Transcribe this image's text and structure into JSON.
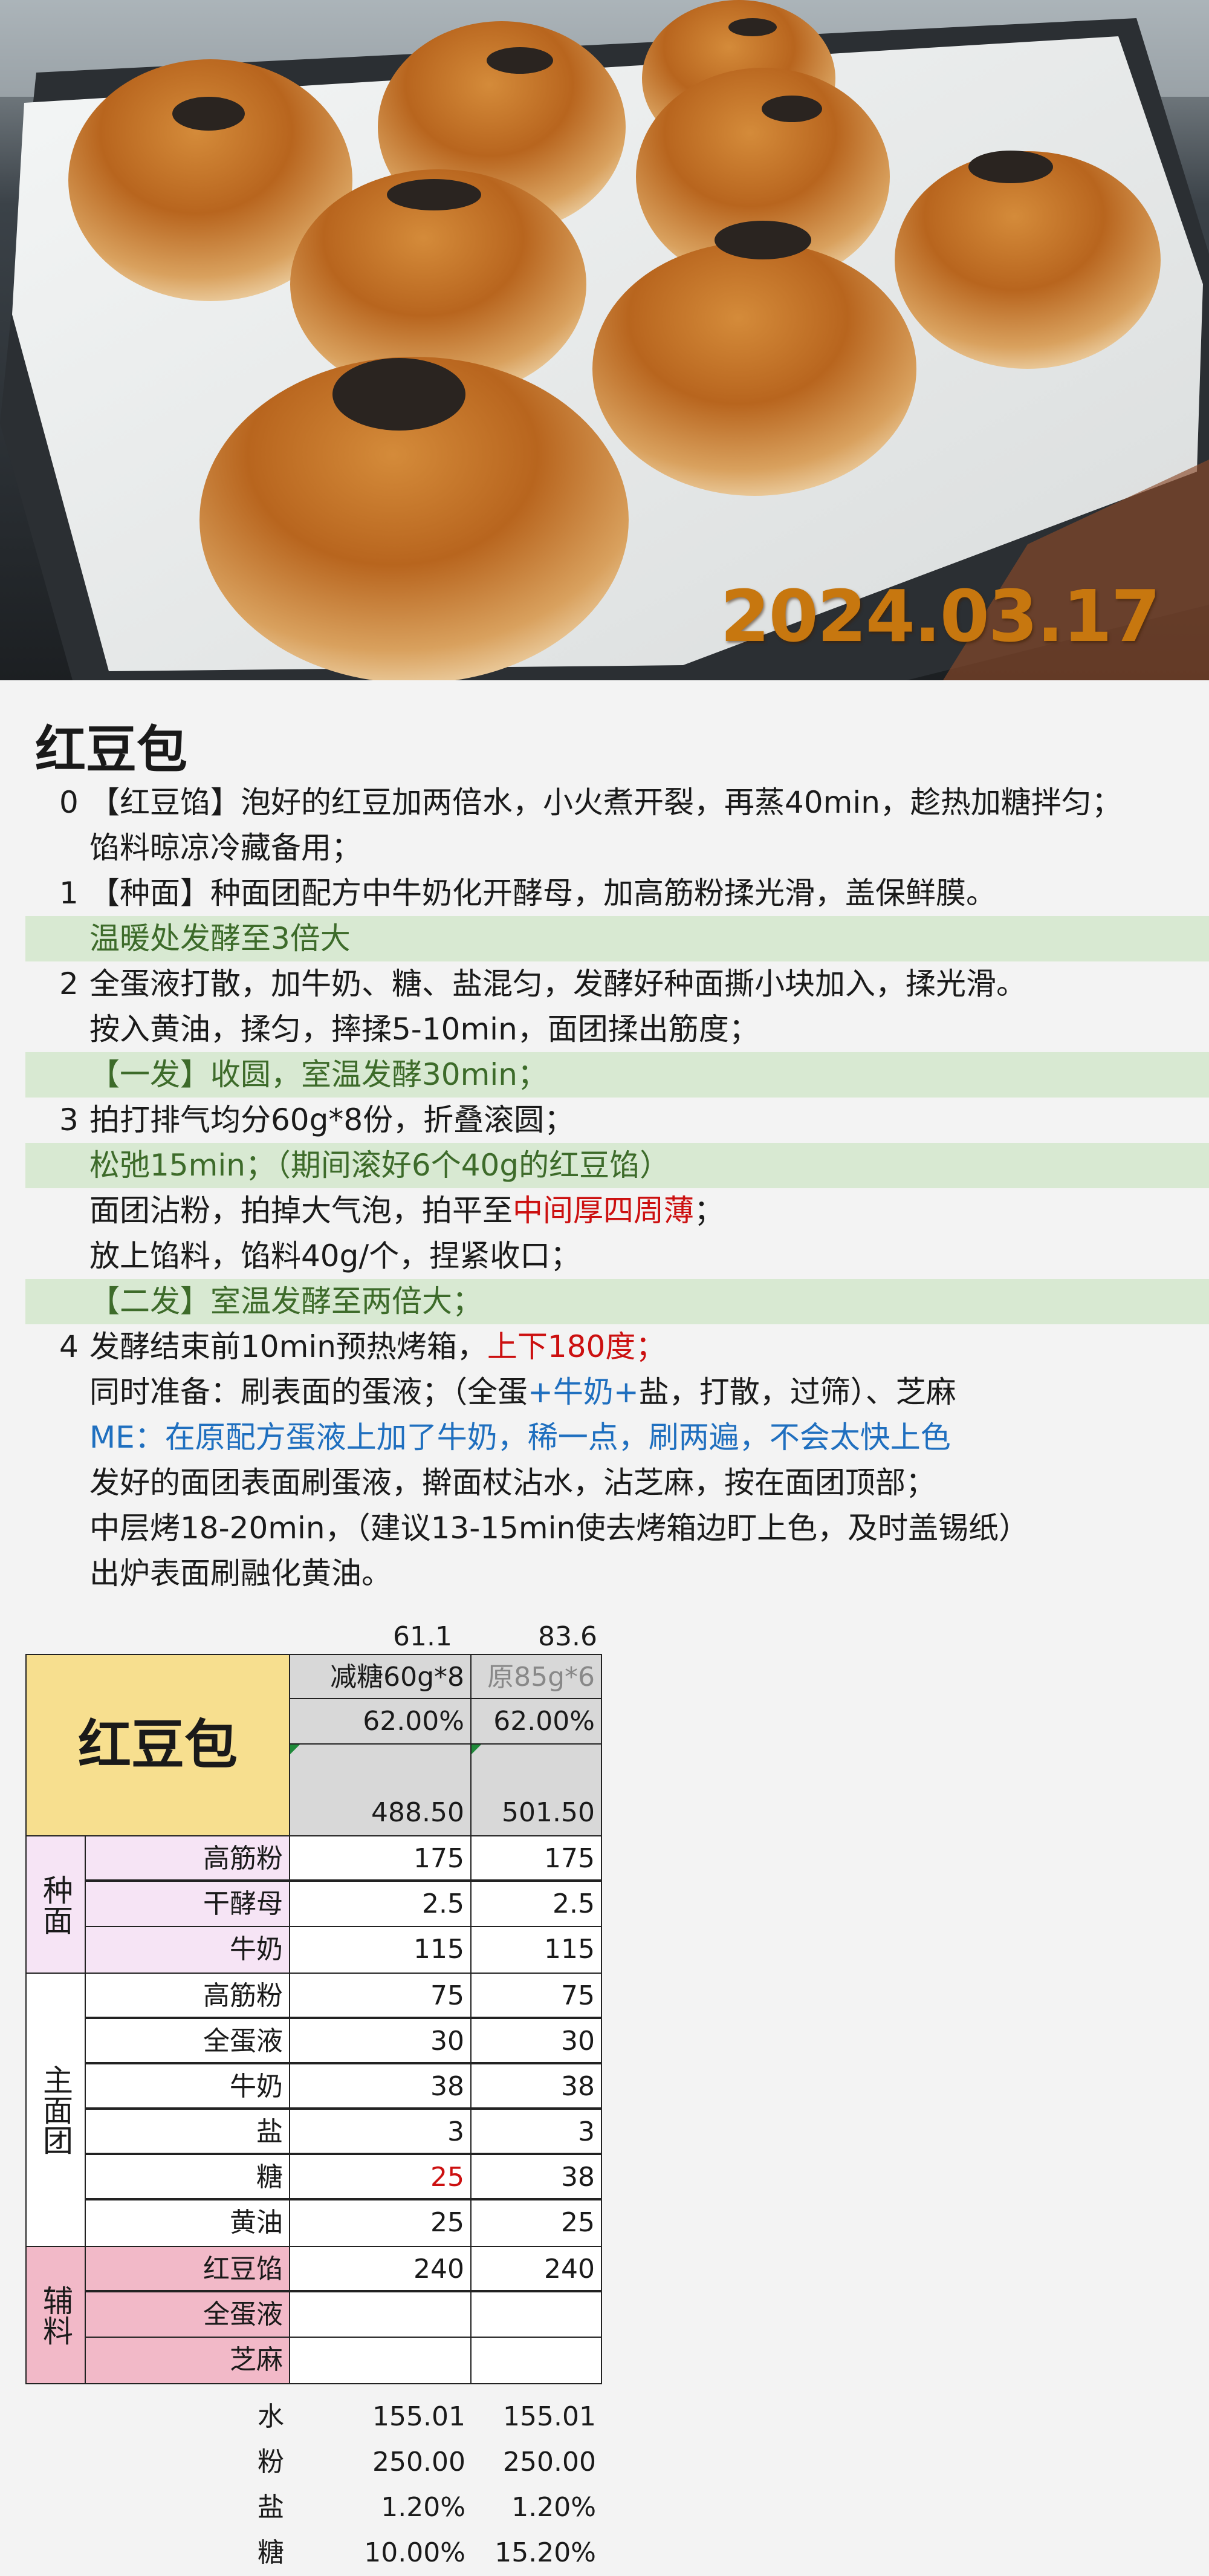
{
  "photo": {
    "date_stamp": "2024.03.17",
    "colors": {
      "stamp": "#c7770f",
      "bun": "#c8782e",
      "paper": "#eef0f0"
    }
  },
  "recipe": {
    "title": "红豆包",
    "steps": [
      {
        "num": "0",
        "text": "【红豆馅】泡好的红豆加两倍水，小火煮开裂，再蒸40min，趁热加糖拌匀；"
      },
      {
        "num": "",
        "text": "馅料晾凉冷藏备用；"
      },
      {
        "num": "1",
        "text": "【种面】种面团配方中牛奶化开酵母，加高筋粉揉光滑，盖保鲜膜。"
      },
      {
        "num": "",
        "text": "温暖处发酵至3倍大",
        "highlight": true
      },
      {
        "num": "2",
        "text": "全蛋液打散，加牛奶、糖、盐混匀，发酵好种面撕小块加入，揉光滑。"
      },
      {
        "num": "",
        "text": "按入黄油，揉匀，摔揉5-10min，面团揉出筋度；"
      },
      {
        "num": "",
        "text": "【一发】收圆，室温发酵30min；",
        "highlight": true
      },
      {
        "num": "3",
        "text": "拍打排气均分60g*8份，折叠滚圆；"
      },
      {
        "num": "",
        "text": "松弛15min；（期间滚好6个40g的红豆馅）",
        "highlight": true
      },
      {
        "num": "",
        "text_a": "面团沾粉，拍掉大气泡，拍平至",
        "text_b": "中间厚四周薄",
        "text_c": "；"
      },
      {
        "num": "",
        "text": "放上馅料，馅料40g/个，捏紧收口；"
      },
      {
        "num": "",
        "text": "【二发】室温发酵至两倍大；",
        "highlight": true
      },
      {
        "num": "4",
        "text_a": "发酵结束前10min预热烤箱，",
        "text_b": "上下180度；"
      },
      {
        "num": "",
        "text_a": "同时准备：刷表面的蛋液；（全蛋",
        "text_b": "+牛奶+",
        "text_c": "盐，打散，过筛）、芝麻"
      },
      {
        "num": "",
        "text": "ME：在原配方蛋液上加了牛奶，稀一点，刷两遍，不会太快上色"
      },
      {
        "num": "",
        "text": "发好的面团表面刷蛋液，擀面杖沾水，沾芝麻，按在面团顶部；"
      },
      {
        "num": "",
        "text": "中层烤18-20min，（建议13-15min使去烤箱边盯上色，及时盖锡纸）"
      },
      {
        "num": "",
        "text": "出炉表面刷融化黄油。"
      }
    ]
  },
  "sheet": {
    "top_values": [
      "61.1",
      "83.6"
    ],
    "title": "红豆包",
    "col_headers": [
      "减糖60g*8",
      "原85g*6"
    ],
    "hydration": [
      "62.00%",
      "62.00%"
    ],
    "totals": [
      "488.50",
      "501.50"
    ],
    "groups": [
      {
        "label": "种面",
        "rows": [
          {
            "name": "高筋粉",
            "a": "175",
            "b": "175"
          },
          {
            "name": "干酵母",
            "a": "2.5",
            "b": "2.5"
          },
          {
            "name": "牛奶",
            "a": "115",
            "b": "115"
          }
        ]
      },
      {
        "label": "主面团",
        "rows": [
          {
            "name": "高筋粉",
            "a": "75",
            "b": "75"
          },
          {
            "name": "全蛋液",
            "a": "30",
            "b": "30"
          },
          {
            "name": "牛奶",
            "a": "38",
            "b": "38"
          },
          {
            "name": "盐",
            "a": "3",
            "b": "3"
          },
          {
            "name": "糖",
            "a": "25",
            "b": "38"
          },
          {
            "name": "黄油",
            "a": "25",
            "b": "25"
          }
        ]
      },
      {
        "label": "辅料",
        "rows": [
          {
            "name": "红豆馅",
            "a": "240",
            "b": "240"
          },
          {
            "name": "全蛋液",
            "a": "",
            "b": ""
          },
          {
            "name": "芝麻",
            "a": "",
            "b": ""
          }
        ]
      }
    ],
    "summary": [
      {
        "name": "水",
        "a": "155.01",
        "b": "155.01"
      },
      {
        "name": "粉",
        "a": "250.00",
        "b": "250.00"
      },
      {
        "name": "盐",
        "a": "1.20%",
        "b": "1.20%"
      },
      {
        "name": "糖",
        "a": "10.00%",
        "b": "15.20%"
      }
    ]
  }
}
